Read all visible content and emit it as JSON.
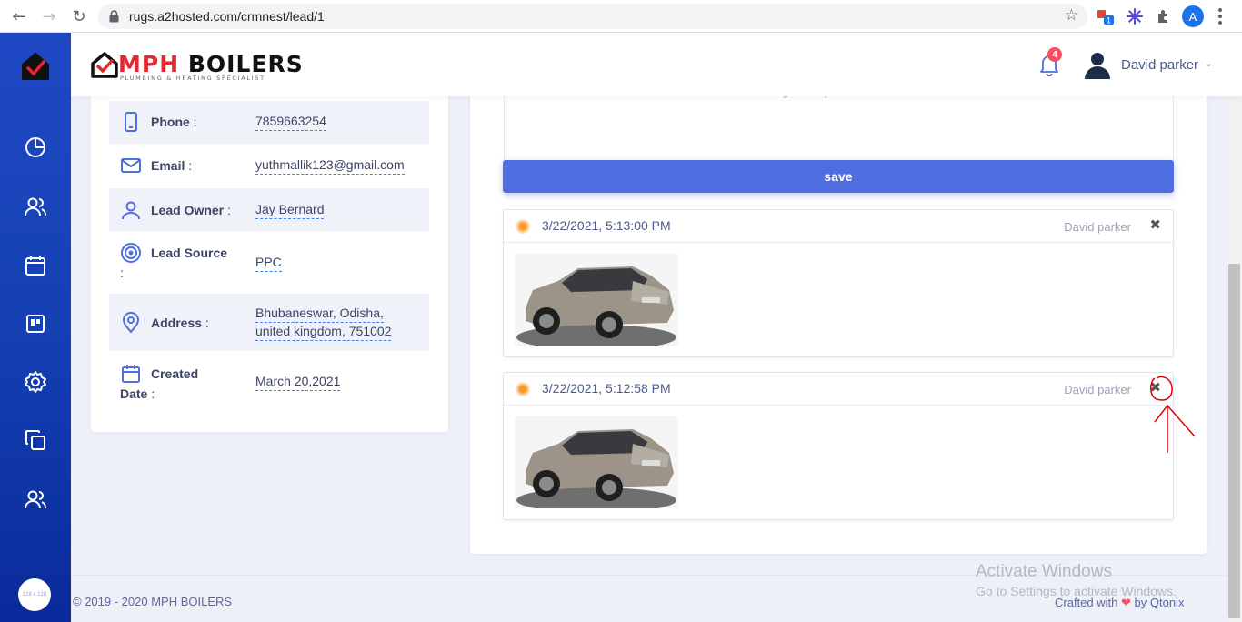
{
  "browser": {
    "url": "rugs.a2hosted.com/crmnest/lead/1",
    "profile_initial": "A",
    "extension_badge": "1"
  },
  "header": {
    "brand_prefix": "MPH",
    "brand_name": "BOILERS",
    "brand_tagline": "PLUMBING & HEATING SPECIALIST",
    "notification_count": "4",
    "user_name": "David parker"
  },
  "sidebar": {
    "items": [
      "dashboard",
      "users",
      "calendar",
      "board",
      "settings",
      "copy",
      "team"
    ],
    "avatar_placeholder": "128 x 128"
  },
  "lead": {
    "fields": [
      {
        "label": "Phone",
        "value": "7859663254",
        "icon": "phone-icon"
      },
      {
        "label": "Email",
        "value": "yuthmallik123@gmail.com",
        "icon": "mail-icon"
      },
      {
        "label": "Lead Owner",
        "value": "Jay Bernard",
        "icon": "user-icon"
      },
      {
        "label": "Lead Source",
        "value": "PPC",
        "icon": "target-icon"
      },
      {
        "label": "Address",
        "value_line1": "Bhubaneswar, Odisha,",
        "value_line2": "united kingdom, 751002",
        "icon": "map-pin-icon"
      },
      {
        "label": "Created",
        "label_line2": "Date",
        "value": "March 20,2021",
        "icon": "calendar-icon"
      }
    ]
  },
  "notes": {
    "dropzone_text": "Drag and drop a file here or click",
    "save_label": "save",
    "items": [
      {
        "date": "3/22/2021, 5:13:00 PM",
        "author": "David parker",
        "image": "suv-photo"
      },
      {
        "date": "3/22/2021, 5:12:58 PM",
        "author": "David parker",
        "image": "suv-photo"
      }
    ]
  },
  "footer": {
    "copyright": "© 2019 - 2020 MPH BOILERS",
    "crafted_prefix": "Crafted with",
    "crafted_suffix": "by Qtonix"
  },
  "watermark": {
    "title": "Activate Windows",
    "subtitle": "Go to Settings to activate Windows."
  },
  "colors": {
    "sidebar": "#1440b3",
    "accent": "#4f6ee0",
    "status_dot": "#f59a23",
    "annotation": "#e00000"
  }
}
